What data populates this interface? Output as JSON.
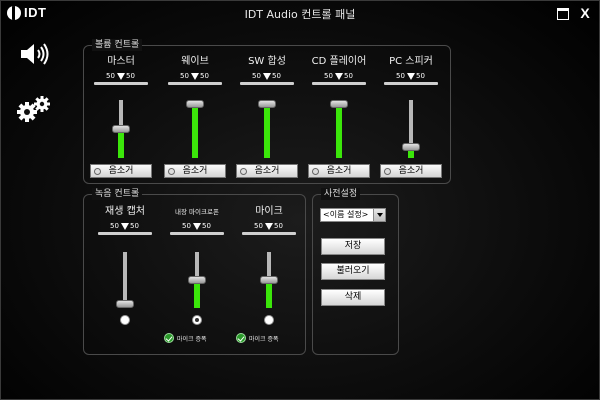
{
  "window": {
    "logo": "IDT",
    "title": "IDT Audio 컨트롤 패널",
    "close_label": "X"
  },
  "sidebar": {
    "icons": [
      "speaker-icon",
      "gears-icon"
    ]
  },
  "volume": {
    "title": "볼륨 컨트롤",
    "mute_label": "음소거",
    "channels": [
      {
        "name": "마스터",
        "bal_l": "50",
        "bal_r": "50",
        "level": 0.5
      },
      {
        "name": "웨이브",
        "bal_l": "50",
        "bal_r": "50",
        "level": 1.0
      },
      {
        "name": "SW 합성",
        "bal_l": "50",
        "bal_r": "50",
        "level": 1.0
      },
      {
        "name": "CD 플레이어",
        "bal_l": "50",
        "bal_r": "50",
        "level": 1.0
      },
      {
        "name": "PC 스피커",
        "bal_l": "50",
        "bal_r": "50",
        "level": 0.15
      }
    ]
  },
  "recording": {
    "title": "녹음 컨트롤",
    "boost_label": "마이크 증폭",
    "channels": [
      {
        "name": "재생 캡처",
        "bal_l": "50",
        "bal_r": "50",
        "level": 0.0,
        "selected": false
      },
      {
        "name": "내장 마이크로폰",
        "bal_l": "50",
        "bal_r": "50",
        "level": 0.5,
        "selected": true
      },
      {
        "name": "마이크",
        "bal_l": "50",
        "bal_r": "50",
        "level": 0.5,
        "selected": false
      }
    ]
  },
  "presets": {
    "title": "사전설정",
    "select_value": "<이름 설정>",
    "save": "저장",
    "load": "불러오기",
    "delete": "삭제"
  },
  "colors": {
    "level_fill": "#3be60a",
    "panel_border": "#4a4a4a"
  }
}
